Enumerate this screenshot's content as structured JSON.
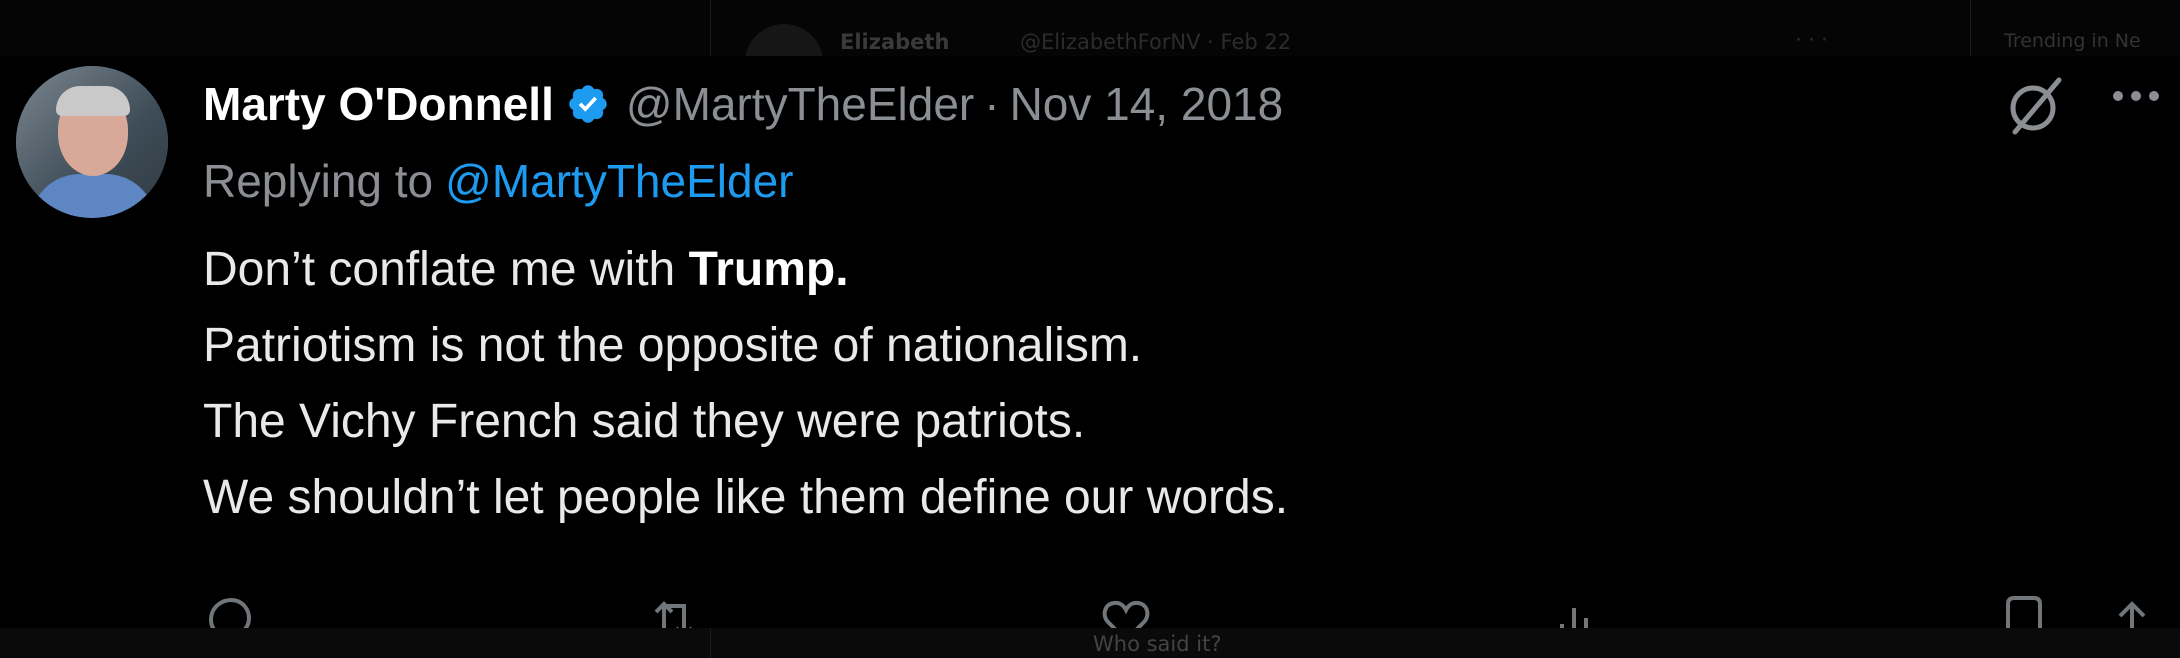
{
  "background": {
    "top_author": "Elizabeth",
    "top_handle": "@ElizabethForNV · Feb 22",
    "trending": "Trending in Ne",
    "bottom_text": "Who said it?"
  },
  "tweet": {
    "display_name": "Marty O'Donnell",
    "handle": "@MartyTheElder",
    "separator": "·",
    "date": "Nov 14, 2018",
    "reply_prefix": "Replying to",
    "reply_target": "@MartyTheElder",
    "body_line1_plain": "Don’t conflate me with ",
    "body_line1_bold": "Trump.",
    "body_line2": "Patriotism is not the opposite of nationalism.",
    "body_line3": "The Vichy French said they were patriots.",
    "body_line4": "We shouldn’t let people like them define our words."
  },
  "actions": {
    "reply_count": "",
    "retweet_count": "",
    "like_count": "",
    "view_count": ""
  },
  "icons": {
    "verified": "verified-badge-icon",
    "grok": "grok-icon",
    "more": "more-icon",
    "reply": "reply-icon",
    "retweet": "retweet-icon",
    "like": "like-icon",
    "views": "views-icon",
    "bookmark": "bookmark-icon",
    "share": "share-icon"
  },
  "colors": {
    "background": "#000000",
    "text": "#e7e9ea",
    "muted": "#8b8f94",
    "link": "#1d9bf0",
    "verified": "#1d9bf0"
  }
}
